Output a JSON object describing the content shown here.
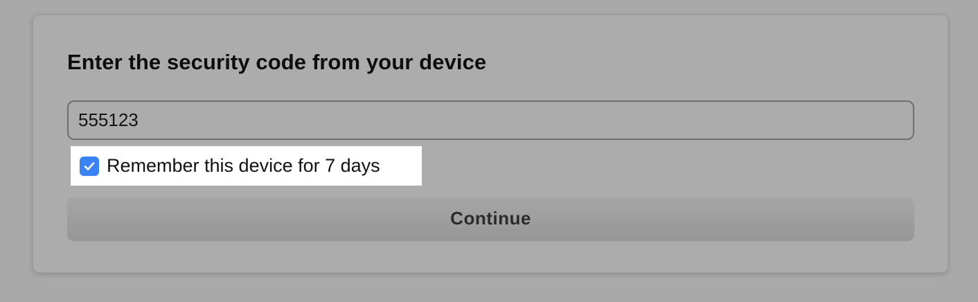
{
  "dialog": {
    "title": "Enter the security code from your device",
    "code_value": "555123",
    "remember": {
      "label": "Remember this device for 7 days",
      "checked": true
    },
    "continue_label": "Continue"
  },
  "colors": {
    "backdrop": "#a9a9a9",
    "card": "#acacac",
    "checkbox_accent": "#3a82f7",
    "highlight": "#ffffff"
  },
  "icons": {
    "checkbox": "checkmark-icon"
  }
}
